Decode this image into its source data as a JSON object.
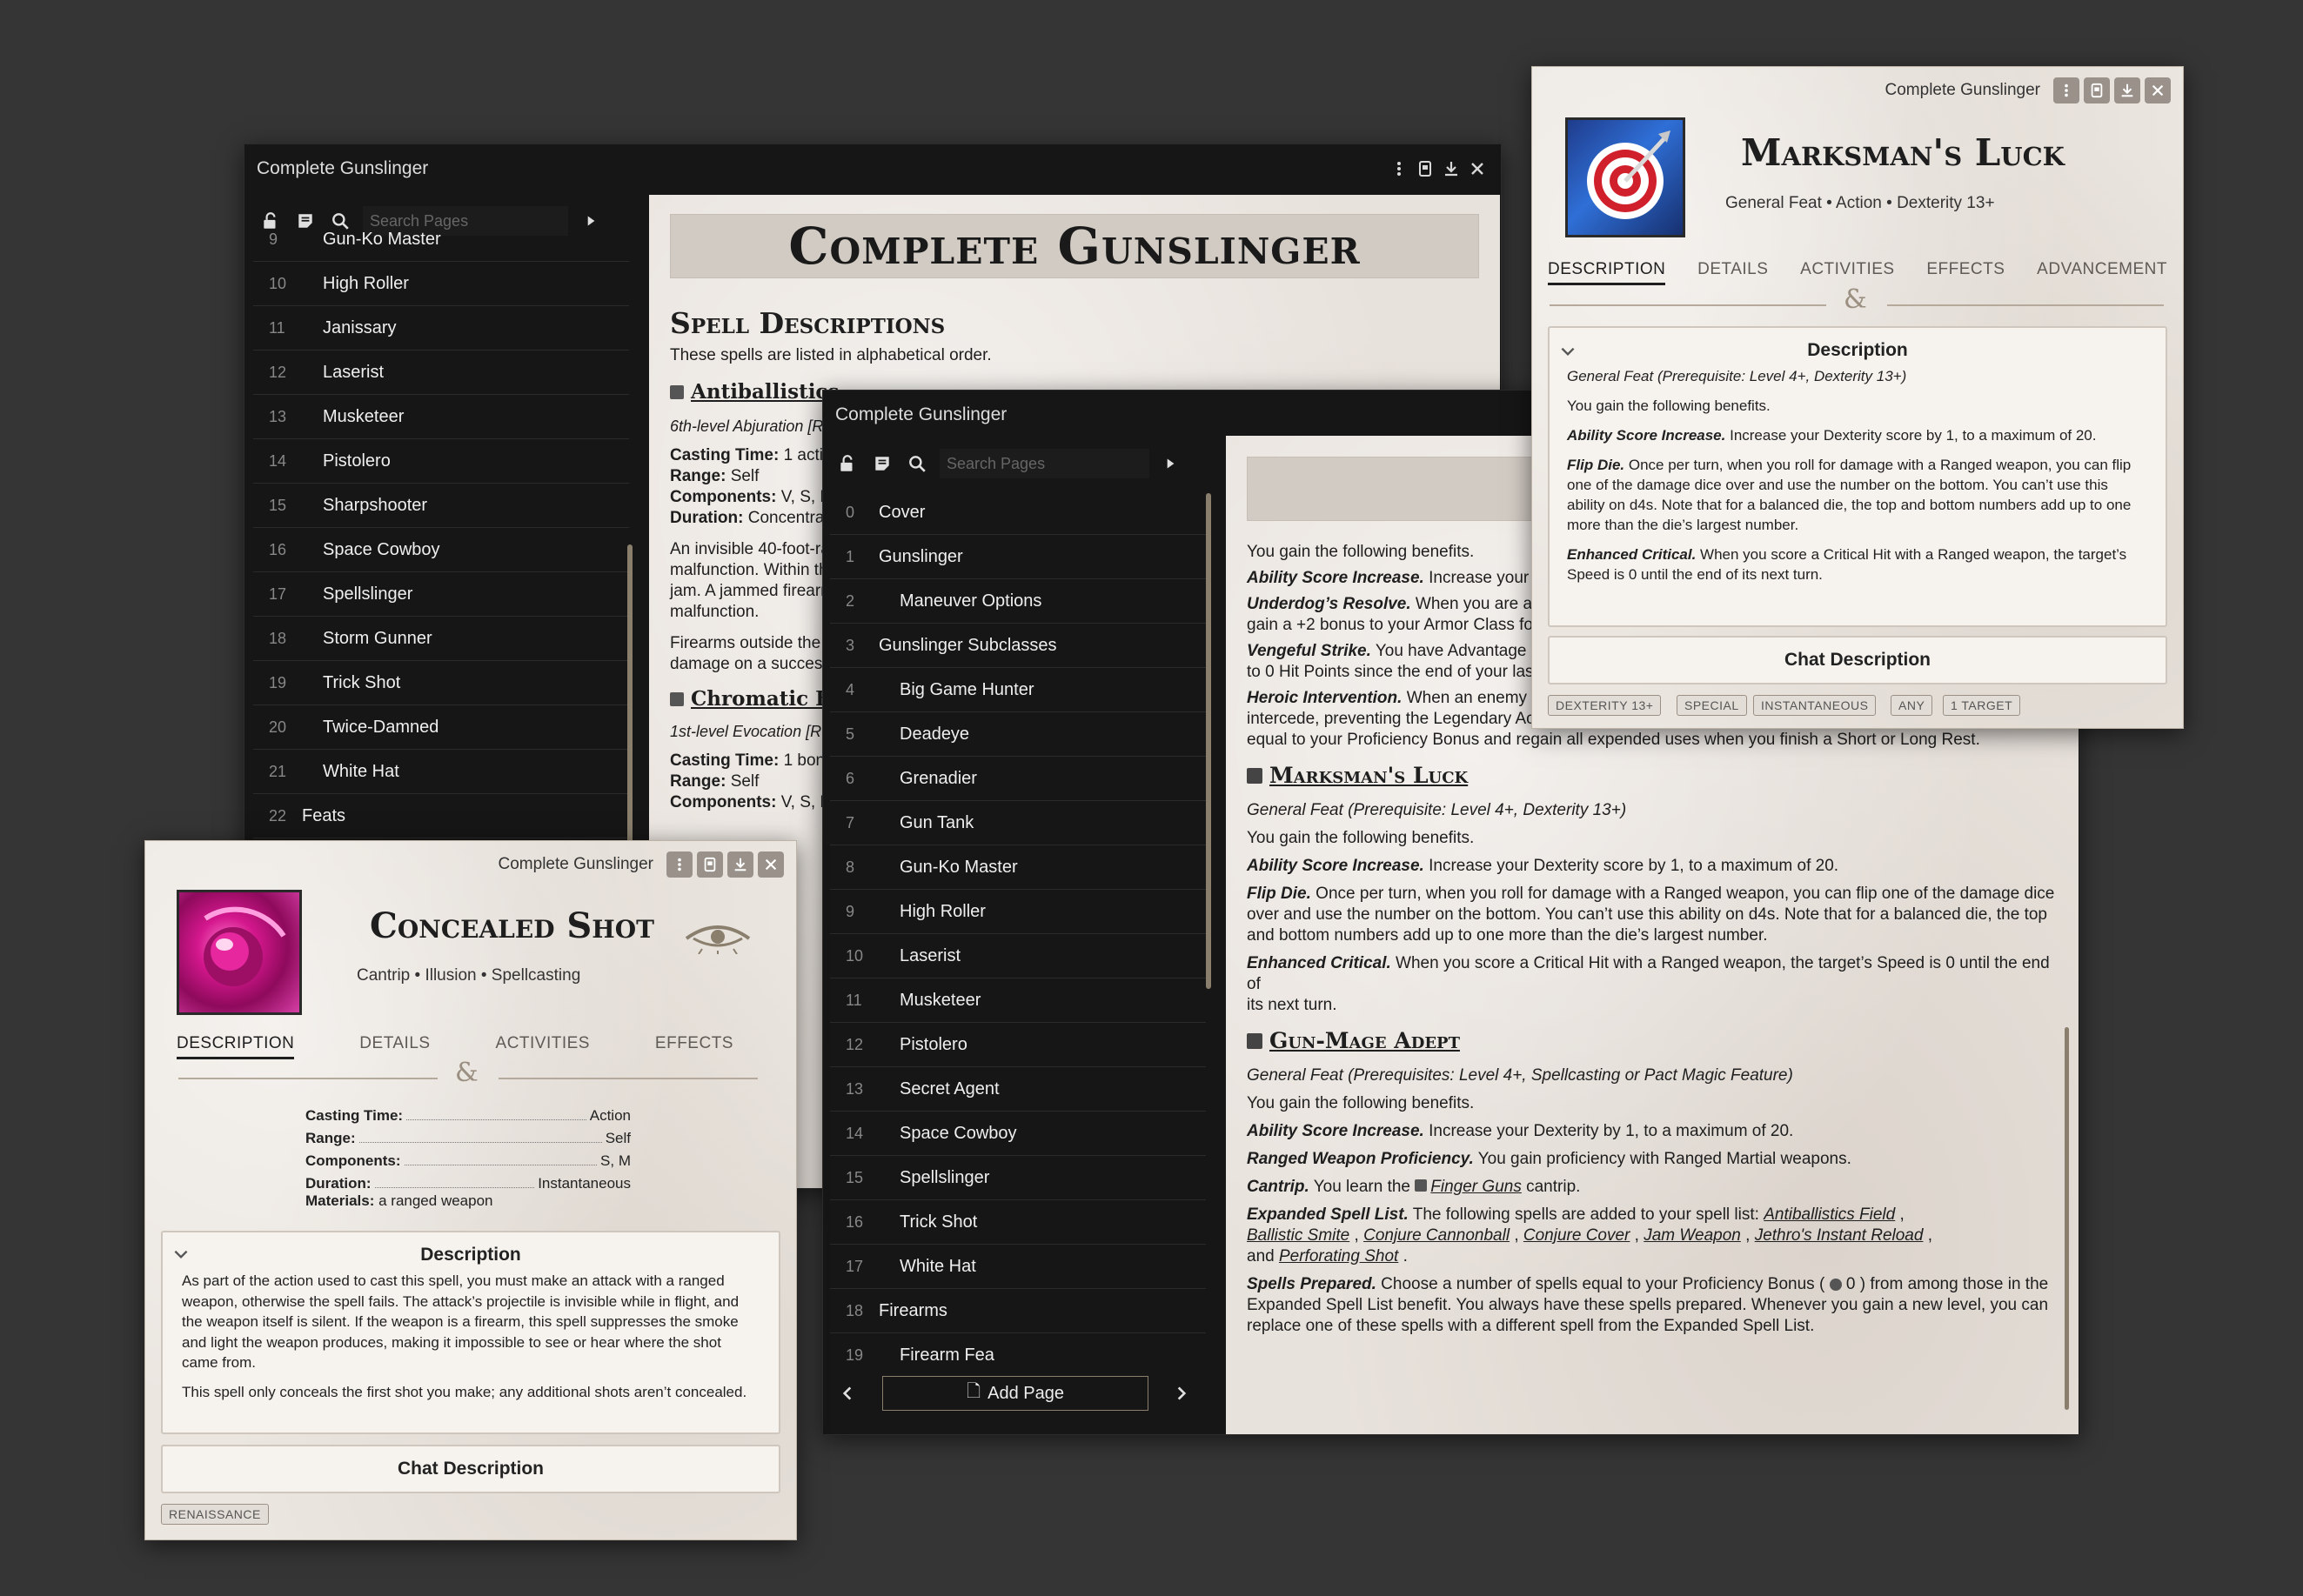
{
  "window_a": {
    "title": "Complete Gunslinger",
    "search_placeholder": "Search Pages",
    "toc": [
      {
        "num": "9",
        "label": "Gun-Ko Master",
        "sub": true
      },
      {
        "num": "10",
        "label": "High Roller",
        "sub": true
      },
      {
        "num": "11",
        "label": "Janissary",
        "sub": true
      },
      {
        "num": "12",
        "label": "Laserist",
        "sub": true
      },
      {
        "num": "13",
        "label": "Musketeer",
        "sub": true
      },
      {
        "num": "14",
        "label": "Pistolero",
        "sub": true
      },
      {
        "num": "15",
        "label": "Sharpshooter",
        "sub": true
      },
      {
        "num": "16",
        "label": "Space Cowboy",
        "sub": true
      },
      {
        "num": "17",
        "label": "Spellslinger",
        "sub": true
      },
      {
        "num": "18",
        "label": "Storm Gunner",
        "sub": true
      },
      {
        "num": "19",
        "label": "Trick Shot",
        "sub": true
      },
      {
        "num": "20",
        "label": "Twice-Damned",
        "sub": true
      },
      {
        "num": "21",
        "label": "White Hat",
        "sub": true
      },
      {
        "num": "22",
        "label": "Feats",
        "sub": false
      }
    ],
    "page": {
      "banner": "Complete Gunslinger",
      "heading": "Spell Descriptions",
      "intro": "These spells are listed in alphabetical order.",
      "spell1_name": "Antiballistics",
      "spell1_school": "6th-level Abjuration [R",
      "spell1_casting_label": "Casting Time:",
      "spell1_casting": "1 actio",
      "spell1_range_label": "Range:",
      "spell1_range": "Self",
      "spell1_components_label": "Components:",
      "spell1_components": "V, S, M",
      "spell1_duration_label": "Duration:",
      "spell1_duration": "Concentrati",
      "spell1_p1a": "An invisible 40-foot-ra",
      "spell1_p1b": "malfunction. Within th",
      "spell1_p1c": "jam. A jammed firearr",
      "spell1_p1d": "malfunction.",
      "spell1_p2a": "Firearms outside the",
      "spell1_p2b": "damage on a success",
      "spell2_name": "Chromatic Bu",
      "spell2_school": "1st-level Evocation [R",
      "spell2_casting_label": "Casting Time:",
      "spell2_casting": "1 bonu",
      "spell2_range_label": "Range:",
      "spell2_range": "Self",
      "spell2_components_label": "Components:",
      "spell2_components": "V, S, M"
    }
  },
  "window_b": {
    "title": "Complete Gunslinger",
    "search_placeholder": "Search Pages",
    "toc": [
      {
        "num": "0",
        "label": "Cover",
        "sub": false
      },
      {
        "num": "1",
        "label": "Gunslinger",
        "sub": false
      },
      {
        "num": "2",
        "label": "Maneuver Options",
        "sub": true
      },
      {
        "num": "3",
        "label": "Gunslinger Subclasses",
        "sub": false
      },
      {
        "num": "4",
        "label": "Big Game Hunter",
        "sub": true
      },
      {
        "num": "5",
        "label": "Deadeye",
        "sub": true
      },
      {
        "num": "6",
        "label": "Grenadier",
        "sub": true
      },
      {
        "num": "7",
        "label": "Gun Tank",
        "sub": true
      },
      {
        "num": "8",
        "label": "Gun-Ko Master",
        "sub": true
      },
      {
        "num": "9",
        "label": "High Roller",
        "sub": true
      },
      {
        "num": "10",
        "label": "Laserist",
        "sub": true
      },
      {
        "num": "11",
        "label": "Musketeer",
        "sub": true
      },
      {
        "num": "12",
        "label": "Pistolero",
        "sub": true
      },
      {
        "num": "13",
        "label": "Secret Agent",
        "sub": true
      },
      {
        "num": "14",
        "label": "Space Cowboy",
        "sub": true
      },
      {
        "num": "15",
        "label": "Spellslinger",
        "sub": true
      },
      {
        "num": "16",
        "label": "Trick Shot",
        "sub": true
      },
      {
        "num": "17",
        "label": "White Hat",
        "sub": true
      },
      {
        "num": "18",
        "label": "Firearms",
        "sub": false
      },
      {
        "num": "19",
        "label": "Firearm Fea",
        "sub": true
      }
    ],
    "add_page": "Add Page",
    "page": {
      "banner": "Comp",
      "p_benefits": "You gain the following benefits.",
      "asi_label": "Ability Score Increase.",
      "asi_text": " Increase your St",
      "underdog_label": "Underdog’s Resolve.",
      "underdog_text1": " When you are attac",
      "underdog_text2": "gain a +2 bonus to your Armor Class for",
      "vengeful_label": "Vengeful Strike.",
      "vengeful_text1": " You have Advantage o",
      "vengeful_text2": "to 0 Hit Points since the end of your las",
      "heroic_label": "Heroic Intervention.",
      "heroic_text1": " When an enemy you",
      "heroic_text2": "intercede, preventing the Legendary Action from happening. You can take this Reaction a number of times",
      "heroic_text3": "equal to your Proficiency Bonus and regain all expended uses when you finish a Short or Long Rest.",
      "mluck_heading": "Marksman's Luck",
      "mluck_prereq": "General Feat (Prerequisite: Level 4+, Dexterity 13+)",
      "mluck_benefits": "You gain the following benefits.",
      "mluck_asi_label": "Ability Score Increase.",
      "mluck_asi_text": " Increase your Dexterity score by 1, to a maximum of 20.",
      "mluck_flip_label": "Flip Die.",
      "mluck_flip_1": " Once per turn, when you roll for damage with a Ranged weapon, you can flip one of the damage dice",
      "mluck_flip_2": "over and use the number on the bottom. You can’t use this ability on d4s. Note that for a balanced die, the top",
      "mluck_flip_3": "and bottom numbers add up to one more than the die’s largest number.",
      "mluck_crit_label": "Enhanced Critical.",
      "mluck_crit_1": " When you score a Critical Hit with a Ranged weapon, the target’s Speed is 0 until the end of",
      "mluck_crit_2": "its next turn.",
      "gma_heading": "Gun-Mage Adept",
      "gma_prereq": "General Feat (Prerequisites: Level 4+, Spellcasting or Pact Magic Feature)",
      "gma_benefits": "You gain the following benefits.",
      "gma_asi_label": "Ability Score Increase.",
      "gma_asi_text": " Increase your Dexterity by 1, to a maximum of 20.",
      "gma_rwp_label": "Ranged Weapon Proficiency.",
      "gma_rwp_text": " You gain proficiency with Ranged Martial weapons.",
      "gma_cantrip_label": "Cantrip.",
      "gma_cantrip_pre": " You learn the ",
      "gma_cantrip_link": "Finger Guns",
      "gma_cantrip_post": " cantrip.",
      "gma_esl_label": "Expanded Spell List.",
      "gma_esl_text": " The following spells are added to your spell list: ",
      "gma_spells": [
        "Antiballistics Field",
        "Ballistic Smite",
        "Conjure Cannonball",
        "Conjure Cover",
        "Jam Weapon",
        "Jethro's Instant Reload",
        "Perforating Shot"
      ],
      "gma_and": "and",
      "gma_sp_label": "Spells Prepared.",
      "gma_sp_1": " Choose a number of spells equal to your Proficiency Bonus (",
      "gma_sp_val": "0",
      "gma_sp_1b": " ) from among those in the",
      "gma_sp_2": "Expanded Spell List benefit. You always have these spells prepared. Whenever you gain a new level, you can",
      "gma_sp_3": "replace one of these spells with a different spell from the Expanded Spell List."
    }
  },
  "window_c": {
    "title": "Complete Gunslinger",
    "name": "Marksman's Luck",
    "subtitle": "General Feat • Action • Dexterity 13+",
    "tabs": [
      "DESCRIPTION",
      "DETAILS",
      "ACTIVITIES",
      "EFFECTS",
      "ADVANCEMENT"
    ],
    "card_title": "Description",
    "prereq": "General Feat (Prerequisite: Level 4+, Dexterity 13+)",
    "benefits": "You gain the following benefits.",
    "asi_label": "Ability Score Increase.",
    "asi_text": " Increase your Dexterity score by 1, to a maximum of 20.",
    "flip_label": "Flip Die.",
    "flip_1": " Once per turn, when you roll for damage with a Ranged weapon, you can flip",
    "flip_2": "one of the damage dice over and use the number on the bottom. You can’t use this",
    "flip_3": "ability on d4s. Note that for a balanced die, the top and bottom numbers add up to one",
    "flip_4": "more than the die’s largest number.",
    "crit_label": "Enhanced Critical.",
    "crit_1": " When you score a Critical Hit with a Ranged weapon, the target’s",
    "crit_2": "Speed is 0 until the end of its next turn.",
    "chat": "Chat Description",
    "tags": [
      "DEXTERITY 13+",
      "SPECIAL",
      "INSTANTANEOUS",
      "ANY",
      "1 TARGET"
    ]
  },
  "window_d": {
    "title": "Complete Gunslinger",
    "name": "Concealed Shot",
    "subtitle": "Cantrip • Illusion • Spellcasting",
    "tabs": [
      "DESCRIPTION",
      "DETAILS",
      "ACTIVITIES",
      "EFFECTS"
    ],
    "stats": [
      {
        "k": "Casting Time:",
        "v": "Action"
      },
      {
        "k": "Range:",
        "v": "Self"
      },
      {
        "k": "Components:",
        "v": "S, M"
      },
      {
        "k": "Duration:",
        "v": "Instantaneous"
      }
    ],
    "materials_label": "Materials:",
    "materials": "a ranged weapon",
    "card_title": "Description",
    "p1_1": "As part of the action used to cast this spell, you must make an attack with a ranged",
    "p1_2": "weapon, otherwise the spell fails. The attack’s projectile is invisible while in flight, and",
    "p1_3": "the weapon itself is silent. If the weapon is a firearm, this spell suppresses the smoke",
    "p1_4": "and light the weapon produces, making it impossible to see or hear where the shot",
    "p1_5": "came from.",
    "p2": "This spell only conceals the first shot you make; any additional shots aren’t concealed.",
    "chat": "Chat Description",
    "tag": "RENAISSANCE"
  },
  "colors": {
    "background": "#353535",
    "dark_window": "#161616",
    "parchment": "#ebe6e0",
    "accent": "#8a7f6d"
  },
  "icons": [
    "menu-dots-icon",
    "book-icon",
    "download-icon",
    "close-icon",
    "unlock-icon",
    "notes-icon",
    "search-icon",
    "caret-right-icon",
    "chevron-left-icon",
    "chevron-right-icon",
    "chevron-down-icon",
    "spell-item-icon",
    "eye-icon",
    "ampersand-icon",
    "target-icon",
    "magic-orb-icon"
  ]
}
